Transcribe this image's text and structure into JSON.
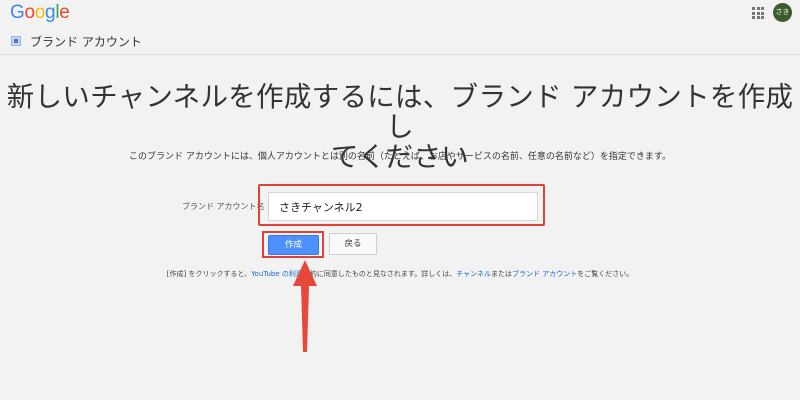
{
  "header": {
    "logo": [
      "G",
      "o",
      "o",
      "g",
      "l",
      "e"
    ],
    "logo_colors": [
      "#4285F4",
      "#EA4335",
      "#FBBC05",
      "#4285F4",
      "#34A853",
      "#EA4335"
    ],
    "avatar_text": "さき"
  },
  "subheader": {
    "title": "ブランド アカウント"
  },
  "main": {
    "headline_line1": "新しいチャンネルを作成するには、ブランド アカウントを作成し",
    "headline_line2": "てください",
    "description": "このブランド アカウントには、個人アカウントとは別の名前（たとえば、お店やサービスの名前、任意の名前など）を指定できます。",
    "field_label": "ブランド アカウント名",
    "field_value": "さきチャンネル2",
    "create_label": "作成",
    "back_label": "戻る"
  },
  "terms": {
    "part1": "[作成] をクリックすると、",
    "link_youtube": "YouTube の利用",
    "part2": "規約に同意したものと見なされます。詳しくは、",
    "link_channel": "チャンネル",
    "part3": "または",
    "link_brand": "ブランド アカウント",
    "part4": "をご覧ください。"
  },
  "annotation": {
    "highlight_color": "#e2413a"
  }
}
